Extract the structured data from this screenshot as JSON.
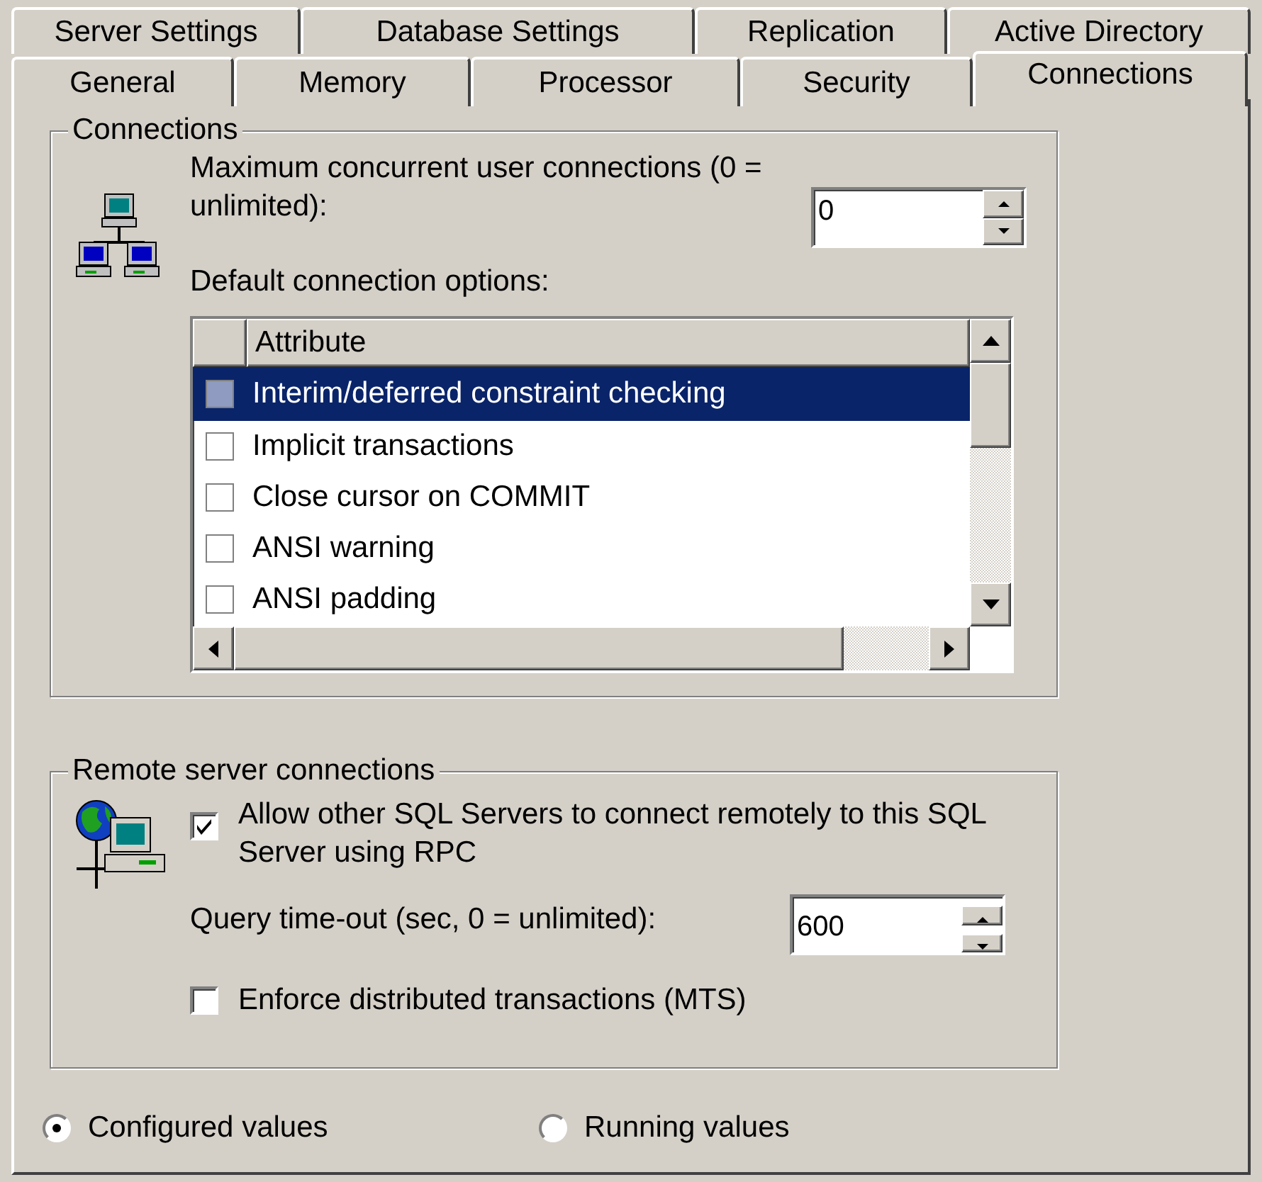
{
  "tab_rows": [
    [
      {
        "label": "Server Settings",
        "selected": false
      },
      {
        "label": "Database Settings",
        "selected": false
      },
      {
        "label": "Replication",
        "selected": false
      },
      {
        "label": "Active Directory",
        "selected": false
      }
    ],
    [
      {
        "label": "General",
        "selected": false
      },
      {
        "label": "Memory",
        "selected": false
      },
      {
        "label": "Processor",
        "selected": false
      },
      {
        "label": "Security",
        "selected": false
      },
      {
        "label": "Connections",
        "selected": true
      }
    ]
  ],
  "connections_group": {
    "title": "Connections",
    "max_connections_label": "Maximum concurrent user connections (0 = unlimited):",
    "max_connections_value": "0",
    "options_label": "Default connection options:",
    "options_table": {
      "columns": [
        "Attribute"
      ],
      "rows": [
        {
          "label": "Interim/deferred constraint checking",
          "checked": false,
          "selected": true
        },
        {
          "label": "Implicit transactions",
          "checked": false,
          "selected": false
        },
        {
          "label": "Close cursor on COMMIT",
          "checked": false,
          "selected": false
        },
        {
          "label": "ANSI warning",
          "checked": false,
          "selected": false
        },
        {
          "label": "ANSI padding",
          "checked": false,
          "selected": false
        }
      ]
    }
  },
  "remote_group": {
    "title": "Remote server connections",
    "allow_rpc": {
      "label": "Allow other SQL Servers to connect remotely to this SQL Server using RPC",
      "checked": true
    },
    "query_timeout_label": "Query time-out (sec, 0 = unlimited):",
    "query_timeout_value": "600",
    "enforce_mts": {
      "label": "Enforce distributed transactions (MTS)",
      "checked": false
    }
  },
  "value_mode": [
    {
      "label": "Configured values",
      "selected": true
    },
    {
      "label": "Running values",
      "selected": false
    }
  ]
}
